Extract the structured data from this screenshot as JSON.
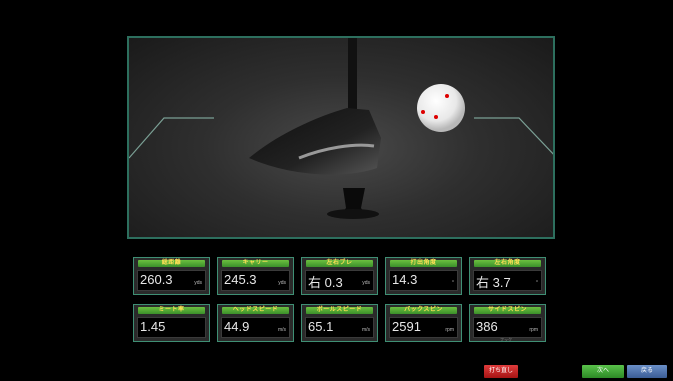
{
  "metrics": [
    {
      "label": "総距離",
      "value": "260.3",
      "unit": "yds"
    },
    {
      "label": "キャリー",
      "value": "245.3",
      "unit": "yds"
    },
    {
      "label": "左右ブレ",
      "value": "右 0.3",
      "unit": "yds"
    },
    {
      "label": "打出角度",
      "value": "14.3",
      "unit": "°"
    },
    {
      "label": "左右角度",
      "value": "右 3.7",
      "unit": "°"
    },
    {
      "label": "ミート率",
      "value": "1.45",
      "unit": ""
    },
    {
      "label": "ヘッドスピード",
      "value": "44.9",
      "unit": "m/s"
    },
    {
      "label": "ボールスピード",
      "value": "65.1",
      "unit": "m/s"
    },
    {
      "label": "バックスピン",
      "value": "2591",
      "unit": "rpm"
    },
    {
      "label": "サイドスピン",
      "value": "386",
      "unit": "rpm",
      "sub": "フック"
    }
  ],
  "buttons": {
    "red": "打ち直し",
    "green": "次へ",
    "blue": "戻る"
  },
  "colors": {
    "frame": "#2d6f5e",
    "header": "#4fa83a",
    "header_text": "#ffdf55"
  }
}
